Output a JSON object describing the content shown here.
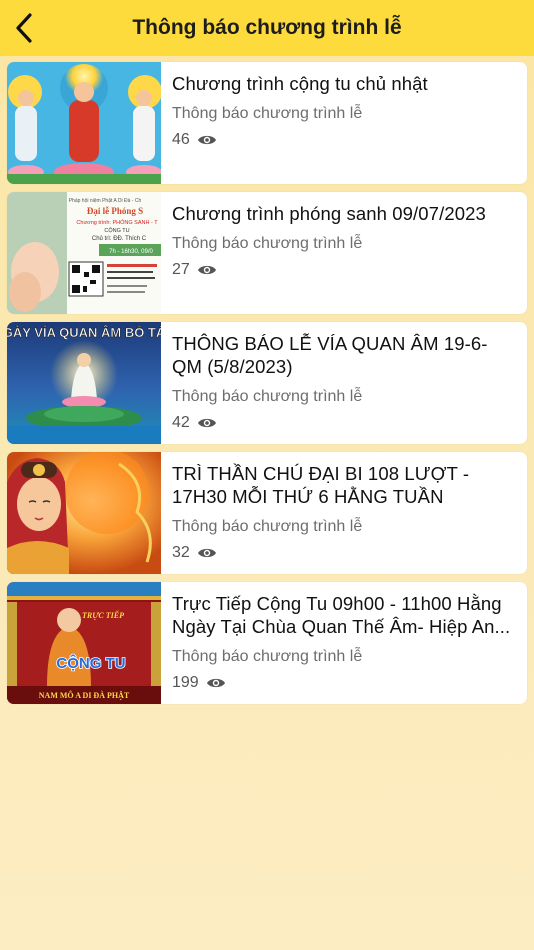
{
  "header": {
    "title": "Thông báo chương trình lễ"
  },
  "items": [
    {
      "title": "Chương trình cộng tu chủ nhật",
      "category": "Thông báo chương trình lễ",
      "views": "46"
    },
    {
      "title": "Chương trình phóng sanh 09/07/2023",
      "category": "Thông báo chương trình lễ",
      "views": "27",
      "thumb_text": [
        "Pháp hội niệm Phật A Di Đà - Ch",
        "Đại lễ Phóng S",
        "Chương trình: PHÓNG SANH - T",
        "CỘNG TU",
        "Chủ trì: ĐĐ. Thích C",
        "7h - 16h30, 09/0"
      ]
    },
    {
      "title": "THÔNG BÁO LỄ VÍA QUAN ÂM 19-6-QM (5/8/2023)",
      "category": "Thông báo chương trình lễ",
      "views": "42",
      "thumb_text": [
        "GÀY VÍA QUAN ÂM BỒ TÁ"
      ]
    },
    {
      "title": "TRÌ THẦN CHÚ ĐẠI BI 108 LƯỢT - 17H30 MỖI THỨ 6 HẰNG TUẦN",
      "category": "Thông báo chương trình lễ",
      "views": "32"
    },
    {
      "title": "Trực Tiếp Cộng Tu 09h00 - 11h00 Hằng Ngày Tại Chùa Quan Thế Âm- Hiệp An...",
      "category": "Thông báo chương trình lễ",
      "views": "199",
      "thumb_text": [
        "TRỰC TIẾP",
        "CỘNG TU",
        "NAM MÔ A DI ĐÀ PHẬT"
      ]
    }
  ],
  "icons": {
    "back": "chevron-left-icon",
    "views": "eye-icon"
  },
  "colors": {
    "header": "#fddb3d",
    "background": "#fbe6a3"
  }
}
